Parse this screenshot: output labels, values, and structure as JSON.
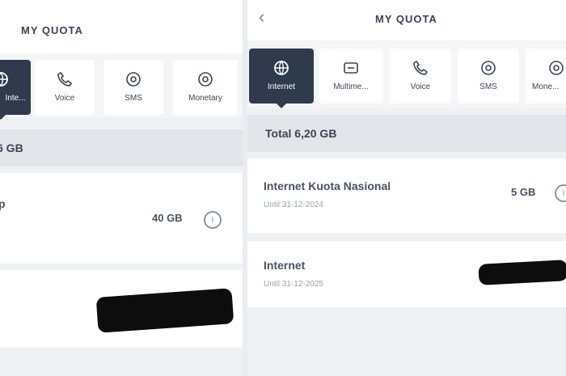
{
  "left": {
    "title": "MY QUOTA",
    "tabs": [
      {
        "label": "Inte..."
      },
      {
        "label": "Voice"
      },
      {
        "label": "SMS"
      },
      {
        "label": "Monetary"
      }
    ],
    "total_label": "6 GB",
    "item": {
      "name": "p",
      "amount": "40 GB"
    }
  },
  "right": {
    "title": "MY QUOTA",
    "tabs": [
      {
        "label": "Internet"
      },
      {
        "label": "Multime..."
      },
      {
        "label": "Voice"
      },
      {
        "label": "SMS"
      },
      {
        "label": "Mone..."
      }
    ],
    "total_label": "Total 6,20 GB",
    "items": [
      {
        "name": "Internet Kuota Nasional",
        "sub": "Until 31-12-2024",
        "amount": "5 GB"
      },
      {
        "name": "Internet",
        "sub": "Until 31-12-2025",
        "amount": ""
      }
    ]
  },
  "colors": {
    "active_tab": "#2f3a4c",
    "panel_bg": "#eef1f4",
    "redaction": "#0d0d0d"
  }
}
